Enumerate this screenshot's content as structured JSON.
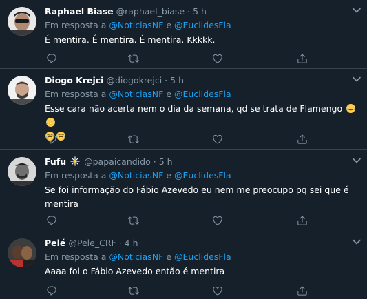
{
  "colors": {
    "background": "#15202b",
    "link": "#1da1f2",
    "muted": "#8899a6",
    "divider": "#38444d"
  },
  "tweets": [
    {
      "name": "Raphael Biase",
      "handle": "@raphael_biase",
      "time": "5 h",
      "reply_prefix": "Em resposta a",
      "mention1": "@NoticiasNF",
      "conj": "e",
      "mention2": "@EuclidesFla",
      "text": "É mentira. É mentira. É mentira. Kkkkk."
    },
    {
      "name": "Diogo Krejci",
      "handle": "@diogokrejci",
      "time": "5 h",
      "reply_prefix": "Em resposta a",
      "mention1": "@NoticiasNF",
      "conj": "e",
      "mention2": "@EuclidesFla",
      "text": "Esse cara não acerta nem o dia da semana, qd se trata de Flamengo",
      "emoji": "face-with-tears-of-joy"
    },
    {
      "name": "Fufu",
      "handle": "@papaicandido",
      "time": "5 h",
      "reply_prefix": "Em resposta a",
      "mention1": "@NoticiasNF",
      "conj": "e",
      "mention2": "@EuclidesFla",
      "text_line1": "Se foi informação do Fábio Azevedo eu nem me preocupo pq sei que é",
      "text_line2": "mentira"
    },
    {
      "name": "Pelé",
      "handle": "@Pele_CRF",
      "time": "4 h",
      "reply_prefix": "Em resposta a",
      "mention1": "@NoticiasNF",
      "conj": "e",
      "mention2": "@EuclidesFla",
      "text": "Aaaa foi o Fábio Azevedo então é mentira"
    }
  ],
  "separator": "·"
}
